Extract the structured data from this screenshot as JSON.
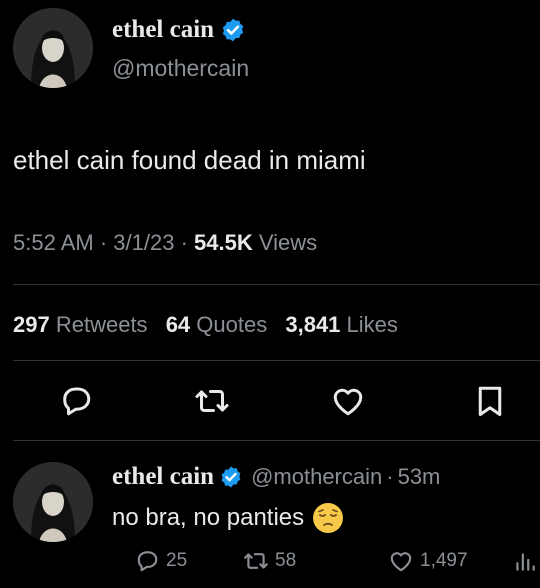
{
  "tweet": {
    "display_name": "ethel cain",
    "handle": "@mothercain",
    "text": "ethel cain found dead in miami",
    "time": "5:52 AM",
    "sep1": "·",
    "date": "3/1/23",
    "sep2": "·",
    "views_count": "54.5K",
    "views_label": "Views",
    "retweets_count": "297",
    "retweets_label": "Retweets",
    "quotes_count": "64",
    "quotes_label": "Quotes",
    "likes_count": "3,841",
    "likes_label": "Likes"
  },
  "reply": {
    "display_name": "ethel cain",
    "handle": "@mothercain",
    "sep": "·",
    "age": "53m",
    "text": "no bra, no panties",
    "emoji": "pensive-face",
    "reply_count": "25",
    "retweet_count": "58",
    "like_count": "1,497"
  },
  "colors": {
    "background": "#000000",
    "primary_text": "#e7e9ea",
    "secondary_text": "#8b9096",
    "verified_badge": "#1d9bf0",
    "divider": "#2f3336"
  },
  "icons": [
    "verified-badge-icon",
    "reply-icon",
    "retweet-icon",
    "like-icon",
    "bookmark-icon",
    "views-icon",
    "pensive-face-emoji"
  ]
}
